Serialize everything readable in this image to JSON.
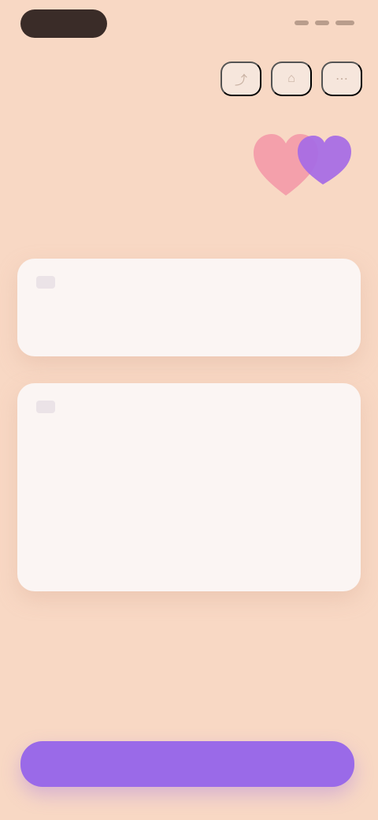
{
  "theme": {
    "background": "#f8d8c4",
    "card_bg": "#fbf5f3",
    "cta": "#9a6ae8",
    "heart_pink": "#f4a0ab",
    "heart_purple": "#a56ae5"
  },
  "top_actions": [
    {
      "icon": "share-icon"
    },
    {
      "icon": "bookmark-icon"
    },
    {
      "icon": "more-icon"
    }
  ],
  "header": {
    "kicker": "",
    "title": ""
  },
  "card_one": {
    "title": "",
    "rows": [
      {
        "index": "",
        "text": ""
      }
    ]
  },
  "card_two": {
    "title": "",
    "rows": [
      {
        "index": "",
        "text": ""
      },
      {
        "index": "",
        "text": ""
      },
      {
        "index": "",
        "text": ""
      }
    ]
  },
  "cta": {
    "label": ""
  }
}
